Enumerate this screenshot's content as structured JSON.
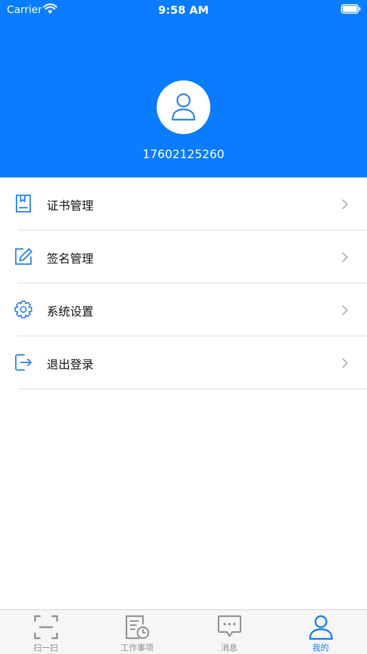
{
  "status_bar": {
    "carrier": "Carrier",
    "time": "9:58 AM"
  },
  "profile": {
    "phone": "17602125260",
    "avatar_icon": "person-icon"
  },
  "menu": {
    "items": [
      {
        "label": "证书管理",
        "icon": "certificate-icon"
      },
      {
        "label": "签名管理",
        "icon": "signature-edit-icon"
      },
      {
        "label": "系统设置",
        "icon": "gear-icon"
      },
      {
        "label": "退出登录",
        "icon": "logout-icon"
      }
    ]
  },
  "tabbar": {
    "tabs": [
      {
        "label": "扫一扫",
        "icon": "scan-icon"
      },
      {
        "label": "工作事项",
        "icon": "task-clock-icon"
      },
      {
        "label": "消息",
        "icon": "message-icon"
      },
      {
        "label": "我的",
        "icon": "person-icon",
        "active": true
      }
    ]
  },
  "colors": {
    "accent": "#0a7cff",
    "inactive": "#8e8e93",
    "divider": "#dcdcdc"
  }
}
